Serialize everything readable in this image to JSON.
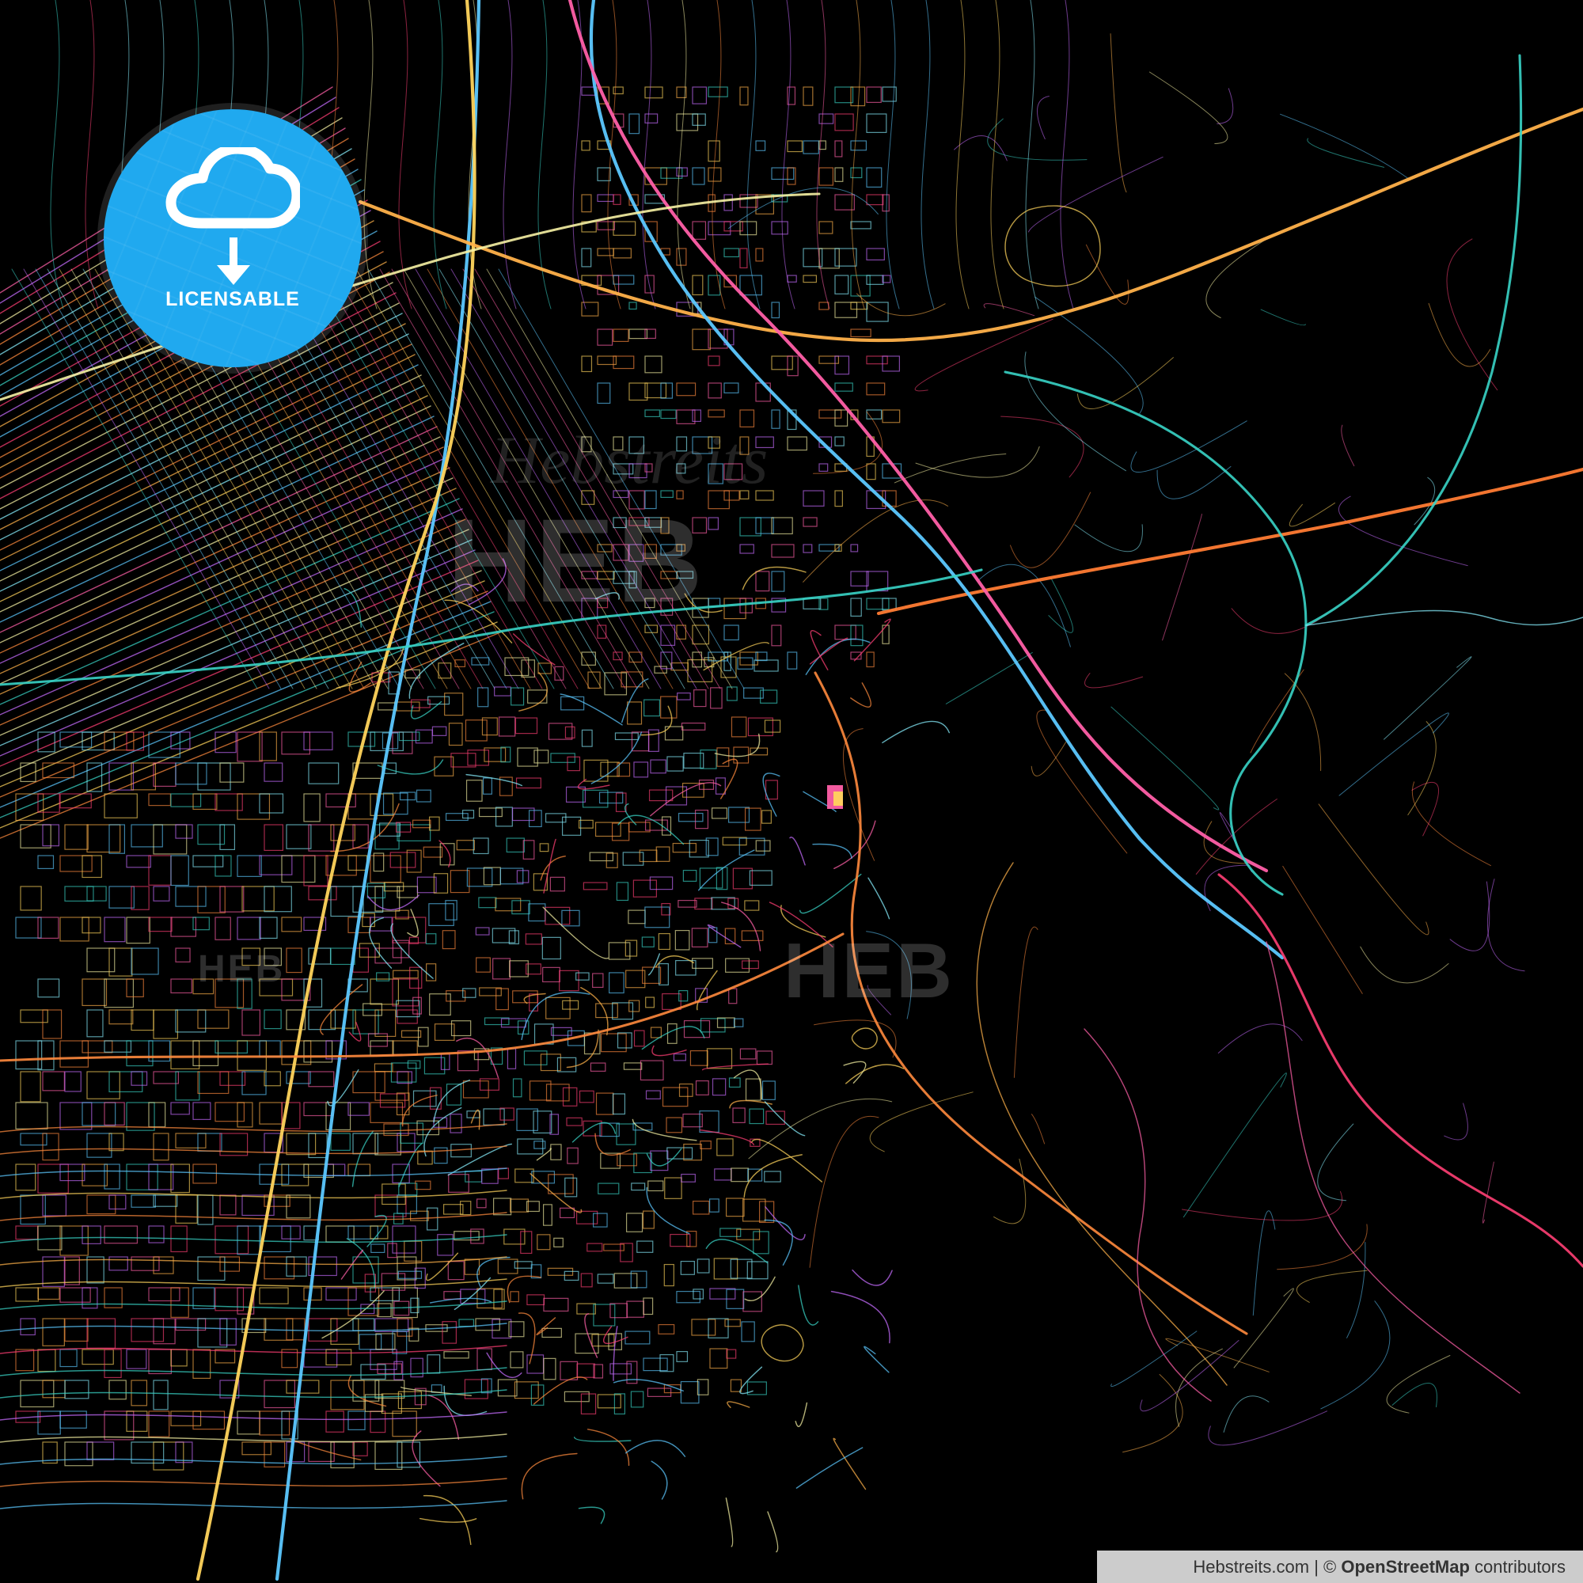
{
  "map": {
    "theme": "colorful street network on black background",
    "background_color": "#000000",
    "road_colors": [
      "#ff5fa8",
      "#ff8a3d",
      "#ffd45c",
      "#5cc8ff",
      "#39d4c6",
      "#c66cff",
      "#f7f2a4",
      "#ff3f74",
      "#88f0ff",
      "#ffb14a"
    ]
  },
  "badge": {
    "label": "LICENSABLE",
    "icon": "cloud-download-icon",
    "color": "#20a9ef"
  },
  "credit": {
    "site": "Hebstreits.com",
    "separator": " | © ",
    "source": "OpenStreetMap",
    "suffix": " contributors"
  }
}
